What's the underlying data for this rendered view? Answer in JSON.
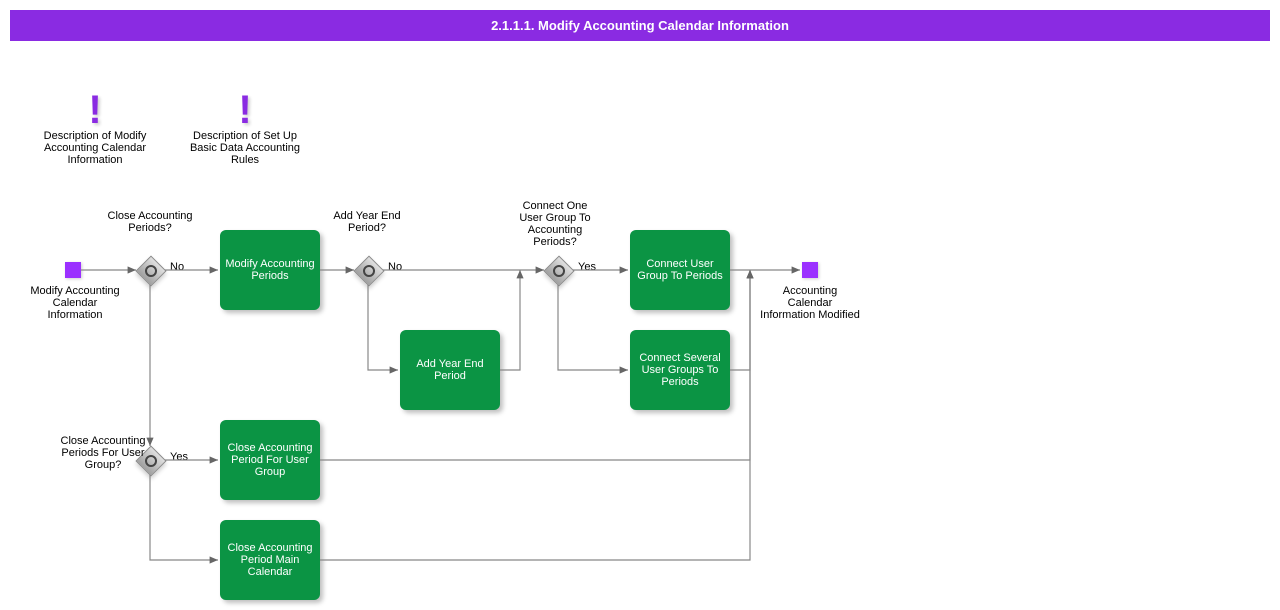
{
  "header": {
    "title": "2.1.1.1. Modify Accounting Calendar Information"
  },
  "info": {
    "desc1": "Description of Modify Accounting Calendar Information",
    "desc2": "Description of Set Up Basic Data Accounting Rules"
  },
  "events": {
    "start_label": "Modify Accounting Calendar Information",
    "end_label": "Accounting Calendar Information Modified"
  },
  "gateways": {
    "g1_label": "Close Accounting Periods?",
    "g2_label": "Add Year End Period?",
    "g3_label": "Connect One User Group To Accounting Periods?",
    "g4_label": "Close Accounting Periods For User Group?"
  },
  "branches": {
    "g1_no": "No",
    "g2_no": "No",
    "g3_yes": "Yes",
    "g4_yes": "Yes"
  },
  "tasks": {
    "t1": "Modify Accounting Periods",
    "t2": "Add Year End Period",
    "t3": "Connect User Group To Periods",
    "t4": "Connect Several User Groups To Periods",
    "t5": "Close Accounting Period For User Group",
    "t6": "Close Accounting Period Main Calendar"
  }
}
